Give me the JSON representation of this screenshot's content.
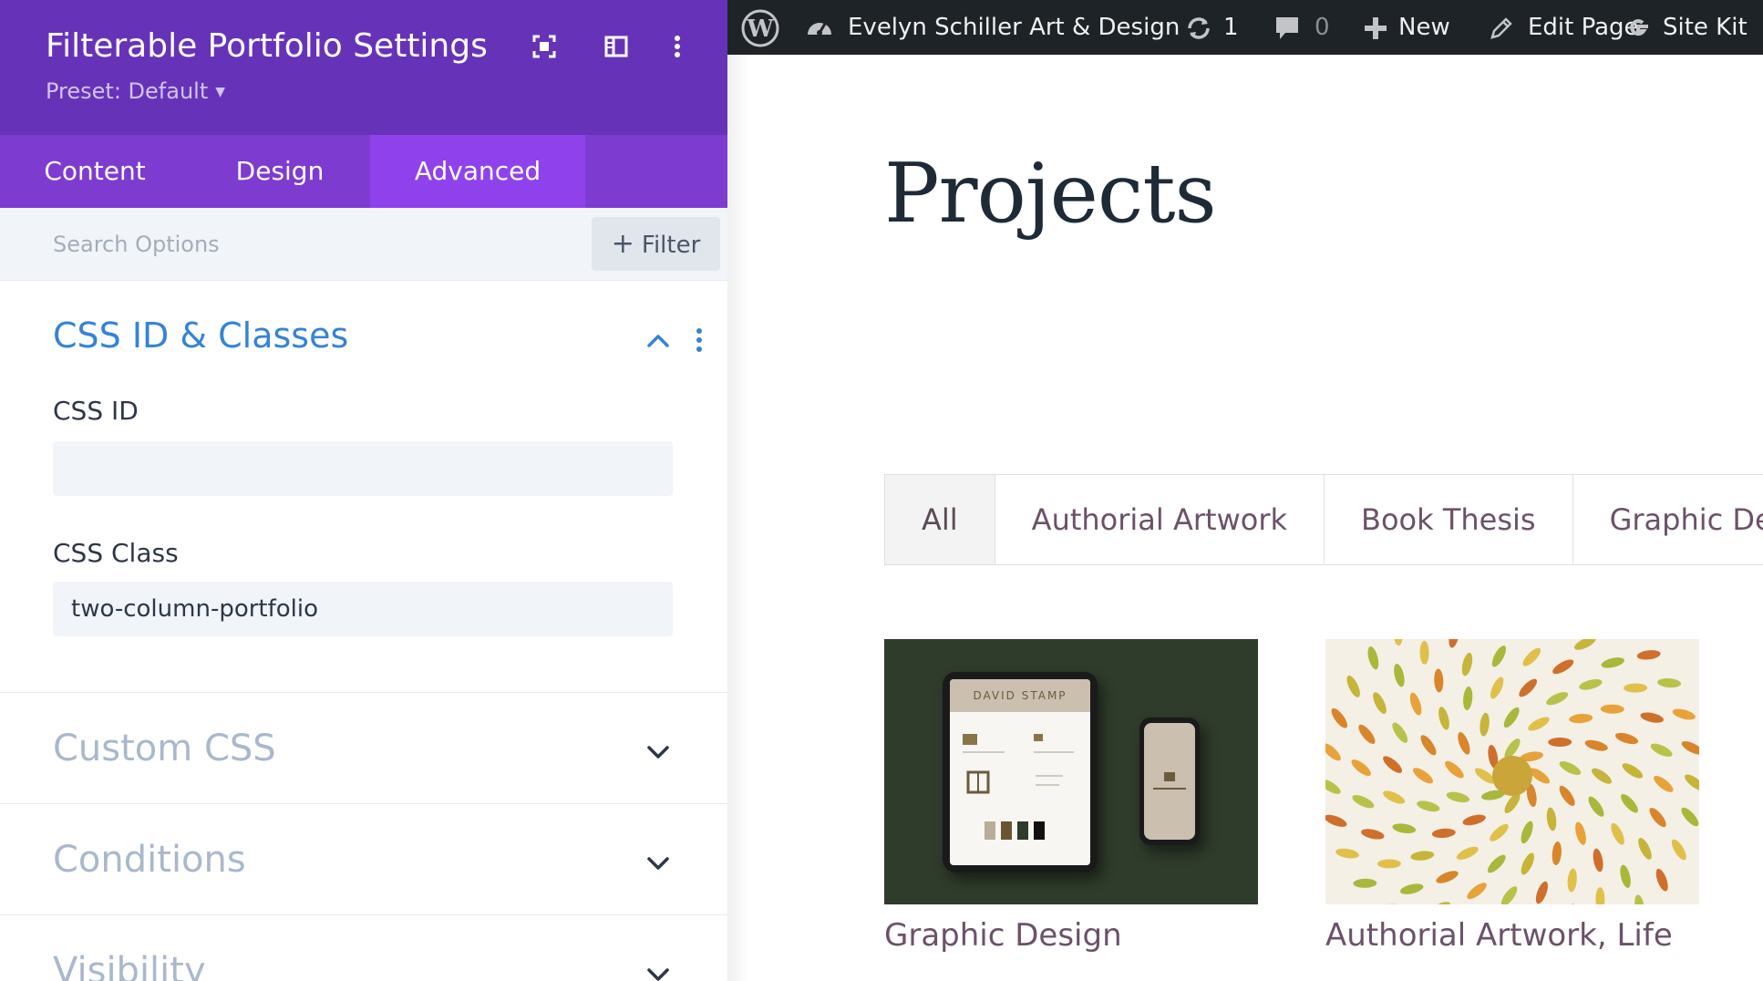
{
  "panel": {
    "title": "Filterable Portfolio Settings",
    "preset": "Preset: Default",
    "tabs": {
      "content": "Content",
      "design": "Design",
      "advanced": "Advanced"
    },
    "search_placeholder": "Search Options",
    "filter_label": "Filter",
    "sections": {
      "css": {
        "title": "CSS ID & Classes",
        "css_id_label": "CSS ID",
        "css_id_value": "",
        "css_class_label": "CSS Class",
        "css_class_value": "two-column-portfolio"
      },
      "custom_css": "Custom CSS",
      "conditions": "Conditions",
      "visibility": "Visibility"
    },
    "colors": {
      "header": "#6633b8",
      "tabs": "#7e3bd0",
      "active_tab": "#8f42ec",
      "section_title": "#3583d6"
    }
  },
  "adminbar": {
    "site_name": "Evelyn Schiller Art & Design",
    "updates": "1",
    "comments": "0",
    "new": "New",
    "edit_page": "Edit Page",
    "site_kit": "Site Kit"
  },
  "page": {
    "heading": "Projects",
    "filters": [
      "All",
      "Authorial Artwork",
      "Book Thesis",
      "Graphic Design"
    ],
    "items": [
      {
        "title": "Graphic Design",
        "thumb_label": "DAVID STAMP"
      },
      {
        "title": "Authorial Artwork, Life"
      }
    ]
  }
}
